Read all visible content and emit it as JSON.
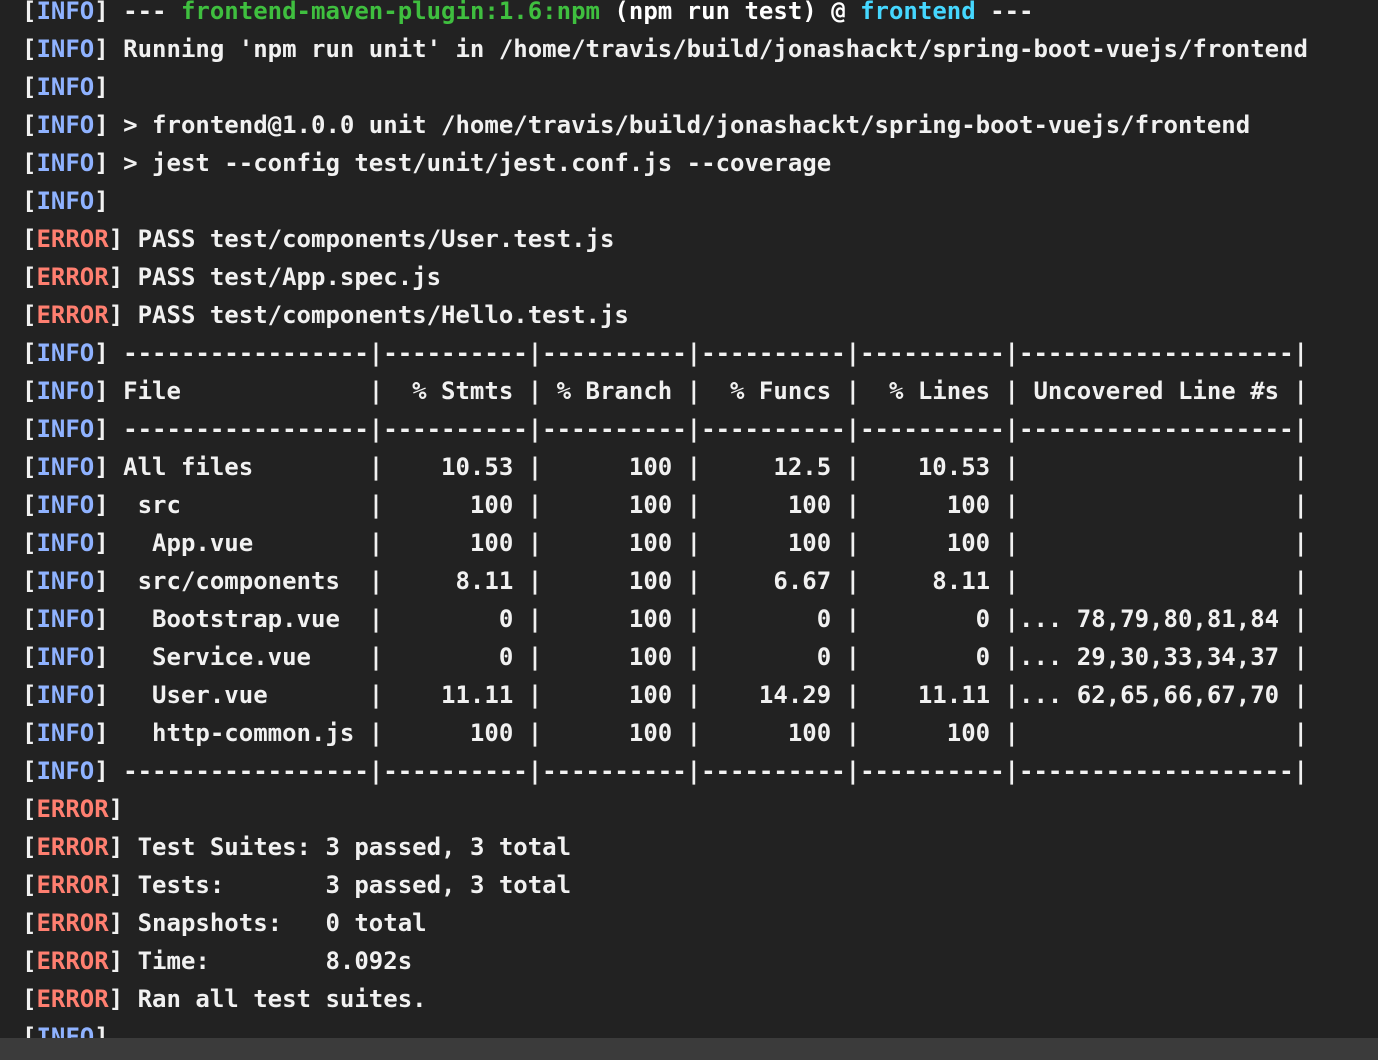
{
  "colors": {
    "background": "#222222",
    "text": "#f1f1f1",
    "info_tag": "#8fb2ff",
    "error_tag": "#ff7f70",
    "plugin_green": "#3fbf3f",
    "project_cyan": "#45d7ff"
  },
  "lines": [
    {
      "level": "INFO",
      "segments": [
        {
          "text": " --- "
        },
        {
          "text": "frontend-maven-plugin:1.6:npm",
          "color": "green"
        },
        {
          "text": " (npm run test) @ ",
          "color": "white"
        },
        {
          "text": "frontend",
          "color": "cyan"
        },
        {
          "text": " ---"
        }
      ]
    },
    {
      "level": "INFO",
      "segments": [
        {
          "text": " Running 'npm run unit' in /home/travis/build/jonashackt/spring-boot-vuejs/frontend"
        }
      ]
    },
    {
      "level": "INFO",
      "segments": [
        {
          "text": ""
        }
      ]
    },
    {
      "level": "INFO",
      "segments": [
        {
          "text": " > frontend@1.0.0 unit /home/travis/build/jonashackt/spring-boot-vuejs/frontend"
        }
      ]
    },
    {
      "level": "INFO",
      "segments": [
        {
          "text": " > jest --config test/unit/jest.conf.js --coverage"
        }
      ]
    },
    {
      "level": "INFO",
      "segments": [
        {
          "text": ""
        }
      ]
    },
    {
      "level": "ERROR",
      "segments": [
        {
          "text": " PASS test/components/User.test.js"
        }
      ]
    },
    {
      "level": "ERROR",
      "segments": [
        {
          "text": " PASS test/App.spec.js"
        }
      ]
    },
    {
      "level": "ERROR",
      "segments": [
        {
          "text": " PASS test/components/Hello.test.js"
        }
      ]
    },
    {
      "level": "INFO",
      "segments": [
        {
          "text": " -----------------|----------|----------|----------|----------|-------------------|"
        }
      ]
    },
    {
      "level": "INFO",
      "segments": [
        {
          "text": " File             |  % Stmts | % Branch |  % Funcs |  % Lines | Uncovered Line #s |"
        }
      ]
    },
    {
      "level": "INFO",
      "segments": [
        {
          "text": " -----------------|----------|----------|----------|----------|-------------------|"
        }
      ]
    },
    {
      "level": "INFO",
      "segments": [
        {
          "text": " All files        |    10.53 |      100 |     12.5 |    10.53 |                   |"
        }
      ]
    },
    {
      "level": "INFO",
      "segments": [
        {
          "text": "  src             |      100 |      100 |      100 |      100 |                   |"
        }
      ]
    },
    {
      "level": "INFO",
      "segments": [
        {
          "text": "   App.vue        |      100 |      100 |      100 |      100 |                   |"
        }
      ]
    },
    {
      "level": "INFO",
      "segments": [
        {
          "text": "  src/components  |     8.11 |      100 |     6.67 |     8.11 |                   |"
        }
      ]
    },
    {
      "level": "INFO",
      "segments": [
        {
          "text": "   Bootstrap.vue  |        0 |      100 |        0 |        0 |... 78,79,80,81,84 |"
        }
      ]
    },
    {
      "level": "INFO",
      "segments": [
        {
          "text": "   Service.vue    |        0 |      100 |        0 |        0 |... 29,30,33,34,37 |"
        }
      ]
    },
    {
      "level": "INFO",
      "segments": [
        {
          "text": "   User.vue       |    11.11 |      100 |    14.29 |    11.11 |... 62,65,66,67,70 |"
        }
      ]
    },
    {
      "level": "INFO",
      "segments": [
        {
          "text": "   http-common.js |      100 |      100 |      100 |      100 |                   |"
        }
      ]
    },
    {
      "level": "INFO",
      "segments": [
        {
          "text": " -----------------|----------|----------|----------|----------|-------------------|"
        }
      ]
    },
    {
      "level": "ERROR",
      "segments": [
        {
          "text": ""
        }
      ]
    },
    {
      "level": "ERROR",
      "segments": [
        {
          "text": " Test Suites: 3 passed, 3 total"
        }
      ]
    },
    {
      "level": "ERROR",
      "segments": [
        {
          "text": " Tests:       3 passed, 3 total"
        }
      ]
    },
    {
      "level": "ERROR",
      "segments": [
        {
          "text": " Snapshots:   0 total"
        }
      ]
    },
    {
      "level": "ERROR",
      "segments": [
        {
          "text": " Time:        8.092s"
        }
      ]
    },
    {
      "level": "ERROR",
      "segments": [
        {
          "text": " Ran all test suites."
        }
      ]
    },
    {
      "level": "INFO",
      "segments": [
        {
          "text": ""
        }
      ]
    }
  ]
}
